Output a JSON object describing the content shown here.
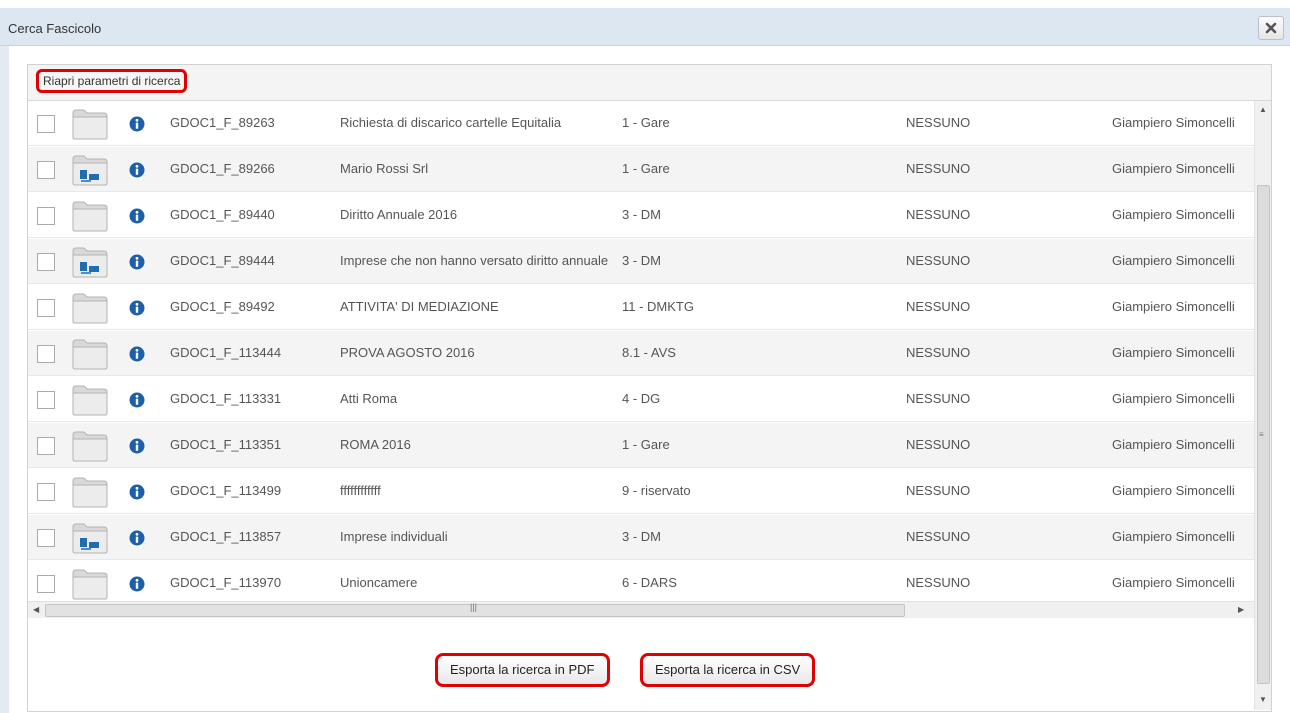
{
  "window": {
    "title": "Cerca Fascicolo"
  },
  "toolbar": {
    "reopen_label": "Riapri parametri di ricerca"
  },
  "rows": [
    {
      "code": "GDOC1_F_89263",
      "description": "Richiesta di discarico cartelle Equitalia",
      "classification": "1 - Gare",
      "reserved": "NESSUNO",
      "manager": "Giampiero Simoncelli",
      "folder_type": "empty"
    },
    {
      "code": "GDOC1_F_89266",
      "description": "Mario Rossi Srl",
      "classification": "1 - Gare",
      "reserved": "NESSUNO",
      "manager": "Giampiero Simoncelli",
      "folder_type": "with-subfolders"
    },
    {
      "code": "GDOC1_F_89440",
      "description": "Diritto Annuale 2016",
      "classification": "3 - DM",
      "reserved": "NESSUNO",
      "manager": "Giampiero Simoncelli",
      "folder_type": "empty"
    },
    {
      "code": "GDOC1_F_89444",
      "description": "Imprese che non hanno versato diritto annuale",
      "classification": "3 - DM",
      "reserved": "NESSUNO",
      "manager": "Giampiero Simoncelli",
      "folder_type": "with-subfolders"
    },
    {
      "code": "GDOC1_F_89492",
      "description": "ATTIVITA' DI MEDIAZIONE",
      "classification": "11 - DMKTG",
      "reserved": "NESSUNO",
      "manager": "Giampiero Simoncelli",
      "folder_type": "empty"
    },
    {
      "code": "GDOC1_F_113444",
      "description": "PROVA AGOSTO 2016",
      "classification": "8.1 - AVS",
      "reserved": "NESSUNO",
      "manager": "Giampiero Simoncelli",
      "folder_type": "empty"
    },
    {
      "code": "GDOC1_F_113331",
      "description": "Atti Roma",
      "classification": "4 - DG",
      "reserved": "NESSUNO",
      "manager": "Giampiero Simoncelli",
      "folder_type": "empty"
    },
    {
      "code": "GDOC1_F_113351",
      "description": "ROMA 2016",
      "classification": "1 - Gare",
      "reserved": "NESSUNO",
      "manager": "Giampiero Simoncelli",
      "folder_type": "empty"
    },
    {
      "code": "GDOC1_F_113499",
      "description": "ffffffffffff",
      "classification": "9 - riservato",
      "reserved": "NESSUNO",
      "manager": "Giampiero Simoncelli",
      "folder_type": "empty"
    },
    {
      "code": "GDOC1_F_113857",
      "description": "Imprese individuali",
      "classification": "3 - DM",
      "reserved": "NESSUNO",
      "manager": "Giampiero Simoncelli",
      "folder_type": "with-subfolders"
    },
    {
      "code": "GDOC1_F_113970",
      "description": "Unioncamere",
      "classification": "6 - DARS",
      "reserved": "NESSUNO",
      "manager": "Giampiero Simoncelli",
      "folder_type": "empty"
    }
  ],
  "actions": {
    "export_pdf_label": "Esporta la ricerca in PDF",
    "export_csv_label": "Esporta la ricerca in CSV"
  },
  "icons": {
    "close": "close-icon",
    "info": "info-icon",
    "folder": "folder-icon"
  },
  "colors": {
    "highlight": "#e00000",
    "info": "#1d5fa8",
    "titlebar": "#dde7f1"
  }
}
